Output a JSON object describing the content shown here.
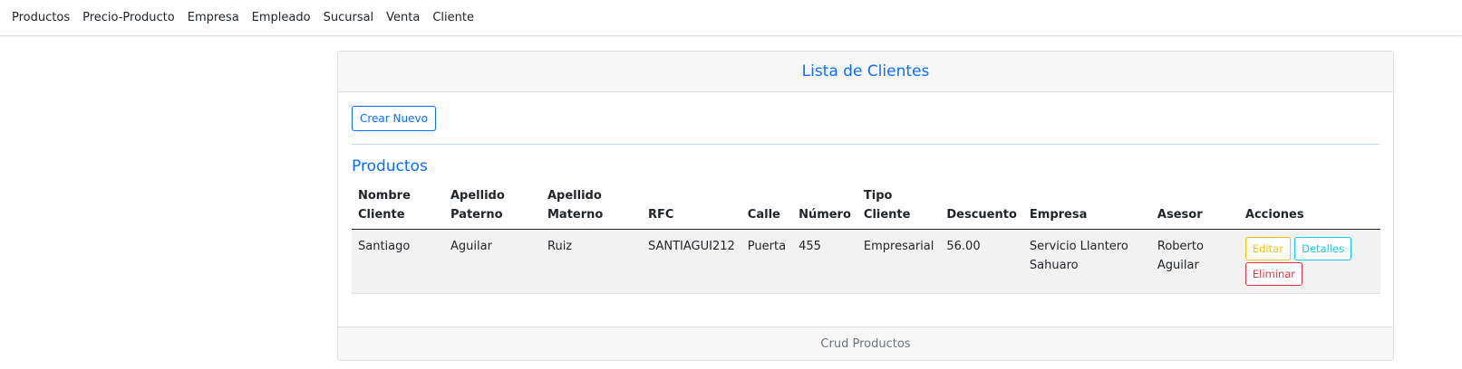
{
  "nav": {
    "items": [
      "Productos",
      "Precio-Producto",
      "Empresa",
      "Empleado",
      "Sucursal",
      "Venta",
      "Cliente"
    ]
  },
  "card": {
    "header_title": "Lista de Clientes",
    "create_button": "Crear Nuevo",
    "section_title": "Productos",
    "footer_text": "Crud Productos"
  },
  "table": {
    "headers": {
      "nombre_l1": "Nombre",
      "nombre_l2": "Cliente",
      "paterno_l1": "Apellido",
      "paterno_l2": "Paterno",
      "materno_l1": "Apellido",
      "materno_l2": "Materno",
      "rfc": "RFC",
      "calle": "Calle",
      "numero": "Número",
      "tipo_l1": "Tipo",
      "tipo_l2": "Cliente",
      "descuento": "Descuento",
      "empresa": "Empresa",
      "asesor": "Asesor",
      "acciones": "Acciones"
    },
    "rows": [
      {
        "nombre": "Santiago",
        "paterno": "Aguilar",
        "materno": "Ruiz",
        "rfc": "SANTIAGUI212",
        "calle": "Puerta",
        "numero": "455",
        "tipo": "Empresarial",
        "descuento": "56.00",
        "empresa_l1": "Servicio Llantero",
        "empresa_l2": "Sahuaro",
        "asesor_l1": "Roberto",
        "asesor_l2": "Aguilar",
        "actions": {
          "edit": "Editar",
          "details": "Detalles",
          "delete": "Eliminar"
        }
      }
    ]
  },
  "colors": {
    "primary": "#0d6efd",
    "warning": "#ffc107",
    "info": "#0dcaf0",
    "danger": "#dc3545"
  }
}
